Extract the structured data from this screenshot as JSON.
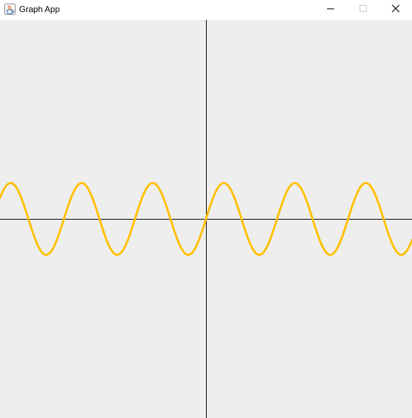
{
  "window": {
    "title": "Graph App",
    "app_icon": "java-coffee-cup-icon",
    "controls": {
      "minimize_icon": "minimize-icon",
      "maximize_icon": "maximize-icon",
      "close_icon": "close-icon"
    }
  },
  "canvas": {
    "background_color": "#eeeeee",
    "axis_color": "#000000"
  },
  "chart_data": {
    "type": "line",
    "function": "sine",
    "series": [
      {
        "color": "#ffc000",
        "amplitude": 1,
        "period": 1,
        "phase": 0
      }
    ],
    "xlim": [
      -2.9,
      2.9
    ],
    "ylim": [
      -5.55,
      5.55
    ],
    "grid": false,
    "axes_visible": true,
    "tick_labels": false
  }
}
